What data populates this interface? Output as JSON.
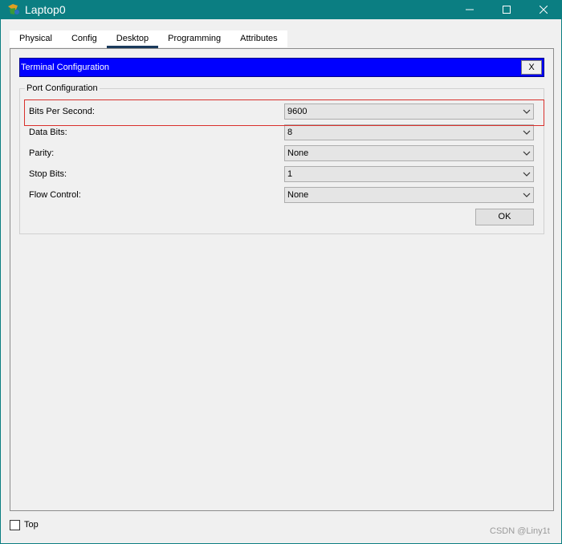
{
  "window": {
    "title": "Laptop0",
    "title_bar_color": "#0b7e82",
    "app_icon": "packet-tracer-icon",
    "controls": [
      "minimize-icon",
      "maximize-icon",
      "close-icon"
    ]
  },
  "tabs": [
    {
      "label": "Physical",
      "active": false
    },
    {
      "label": "Config",
      "active": false
    },
    {
      "label": "Desktop",
      "active": true
    },
    {
      "label": "Programming",
      "active": false
    },
    {
      "label": "Attributes",
      "active": false
    }
  ],
  "terminal": {
    "header_title": "Terminal Configuration",
    "header_color": "#0000ff",
    "close_label": "X",
    "group_title": "Port Configuration",
    "fields": [
      {
        "label": "Bits Per Second:",
        "value": "9600"
      },
      {
        "label": "Data Bits:",
        "value": "8"
      },
      {
        "label": "Parity:",
        "value": "None"
      },
      {
        "label": "Stop Bits:",
        "value": "1"
      },
      {
        "label": "Flow Control:",
        "value": "None"
      }
    ],
    "ok_label": "OK",
    "highlight_color": "#d9302c"
  },
  "footer": {
    "checkbox_label": "Top",
    "checkbox_checked": false,
    "watermark": "CSDN @Liny1t"
  }
}
